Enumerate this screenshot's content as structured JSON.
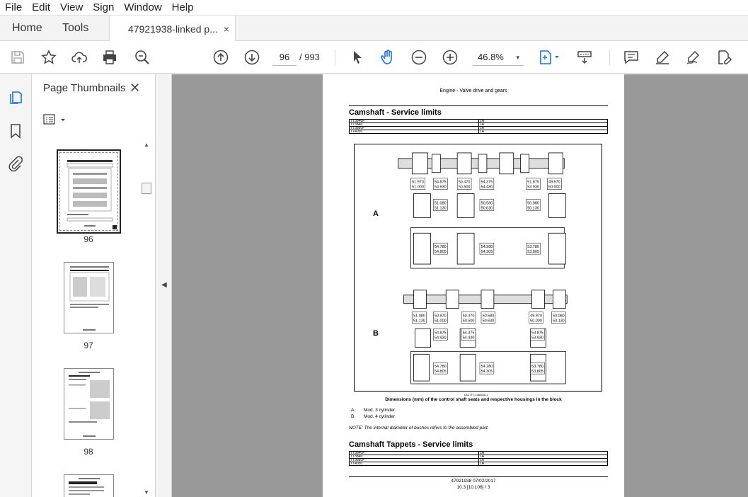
{
  "menu": [
    "File",
    "Edit",
    "View",
    "Sign",
    "Window",
    "Help"
  ],
  "tabs": {
    "home": "Home",
    "tools": "Tools",
    "document": "47921938-linked p...",
    "close": "×"
  },
  "toolbar": {
    "current_page": "96",
    "page_total": "/ 993",
    "zoom": "46.8%",
    "zoom_caret": "▾"
  },
  "sidebar": {
    "title": "Page Thumbnails",
    "close": "✕",
    "thumbnails": [
      {
        "num": "96",
        "selected": true
      },
      {
        "num": "97",
        "selected": false
      },
      {
        "num": "98",
        "selected": false
      }
    ],
    "collapse_arrow": "◀"
  },
  "document": {
    "header": "Engine - Valve drive and gears",
    "section1": {
      "title": "Camshaft - Service limits",
      "rows": [
        [
          "TT3840F",
          "LA"
        ],
        [
          "TT3840",
          "LA"
        ],
        [
          "TT3880F",
          "LA"
        ],
        [
          "TT4030",
          "LA"
        ]
      ]
    },
    "figure": {
      "label_a": "A",
      "label_b": "B",
      "ref": "LA17TT-1084MA  1",
      "caption": "Dimensions (mm) of the control shaft seats and respective housings in the block",
      "dims_a_top": [
        "51.970\n51.000",
        "54.875\n54.930",
        "50.470\n50.500",
        "54.375\n54.430",
        "51.875\n53.930",
        "49.970\n50.000"
      ],
      "dims_a_mid": [
        "51.080\n51.130",
        "50.580\n50.630",
        "50.080\n50.130"
      ],
      "dims_a_bot": [
        "54.780\n54.805",
        "54.280\n54.305",
        "53.780\n53.805"
      ],
      "dims_b_top": [
        "51.080\n51.130",
        "50.970\n51.000",
        "50.470\n50.500",
        "50.580\n50.630",
        "49.970\n50.000",
        "50.080\n50.130"
      ],
      "dims_b_mid": [
        "54.875\n54.930",
        "54.375\n54.430",
        "53.875\n53.930"
      ],
      "dims_b_bot": [
        "54.780\n54.805",
        "54.280\n54.305",
        "53.780\n53.805"
      ]
    },
    "legend": [
      {
        "key": "A.",
        "text": "Mod. 3 cylinder"
      },
      {
        "key": "B.",
        "text": "Mod. 4 cylinder"
      }
    ],
    "note": "NOTE: The internal diameter of bushes refers to the assembled part.",
    "section2": {
      "title": "Camshaft Tappets - Service limits",
      "rows": [
        [
          "TT3840F",
          "LA"
        ],
        [
          "TT3840",
          "LA"
        ],
        [
          "TT3880F",
          "LA"
        ],
        [
          "TT4030",
          "LA"
        ]
      ]
    },
    "footer1": "47921938 07/02/2017",
    "footer2": "10.3 [10.106] / 3"
  }
}
